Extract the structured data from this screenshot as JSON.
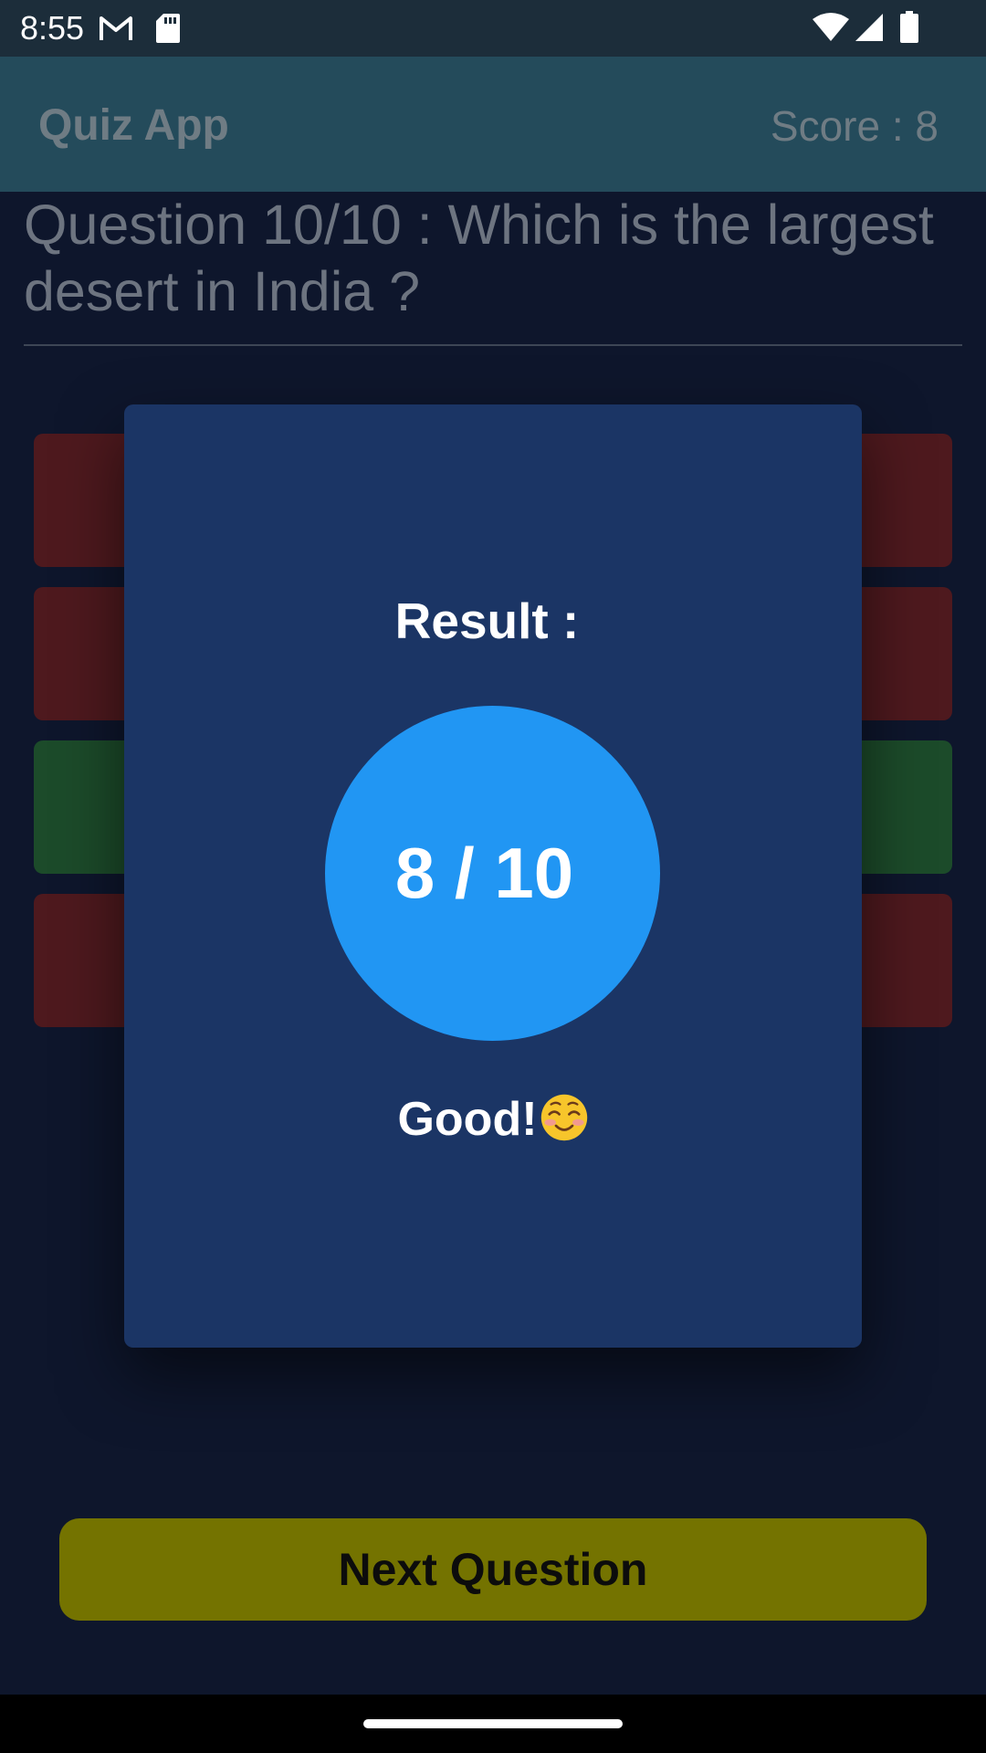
{
  "status_bar": {
    "time": "8:55",
    "icons": [
      "gmail-icon",
      "sd-card-icon",
      "wifi-icon",
      "signal-icon",
      "battery-icon"
    ]
  },
  "app_bar": {
    "title": "Quiz App",
    "score": "Score : 8"
  },
  "question": {
    "text": "Question 10/10 : Which is the largest desert in India ?"
  },
  "options": [
    {
      "state": "wrong",
      "color": "#4e191e"
    },
    {
      "state": "wrong",
      "color": "#4e191e"
    },
    {
      "state": "correct",
      "color": "#1c4b2a"
    },
    {
      "state": "wrong",
      "color": "#4e191e"
    }
  ],
  "dialog": {
    "result_label": "Result :",
    "score": "8 / 10",
    "verdict": "Good!",
    "verdict_emoji": "smiling-face-icon"
  },
  "next_button": {
    "label": "Next Question"
  },
  "colors": {
    "background": "#0e162c",
    "app_bar": "#244b5b",
    "dialog": "#1b3565",
    "score_circle": "#2196f3",
    "next_button": "#747300"
  }
}
